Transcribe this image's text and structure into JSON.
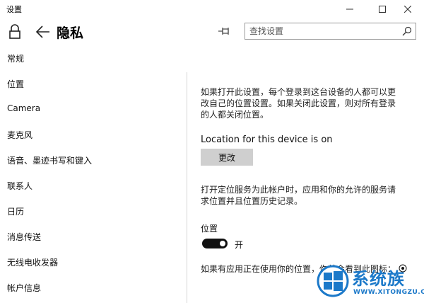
{
  "window": {
    "title": "设置"
  },
  "header": {
    "page_title": "隐私",
    "search_placeholder": "查找设置"
  },
  "sidebar": {
    "items": [
      {
        "label": "常规"
      },
      {
        "label": "位置"
      },
      {
        "label": "Camera"
      },
      {
        "label": "麦克风"
      },
      {
        "label": "语音、墨迹书写和键入"
      },
      {
        "label": "联系人"
      },
      {
        "label": "日历"
      },
      {
        "label": "消息传送"
      },
      {
        "label": "无线电收发器"
      },
      {
        "label": "帐户信息"
      }
    ]
  },
  "main": {
    "description": [
      "如果打开此设置，每个登录到这台设备的人都可以更",
      "改自己的位置设置。如果关闭此设置，则对所有登录",
      "的人都关闭位置。"
    ],
    "device_status": "Location for this device is on",
    "change_button": "更改",
    "service_desc": [
      "打开定位服务为此帐户时，应用和你的允许的服务请",
      "求位置并且位置历史记录。"
    ],
    "location_label": "位置",
    "location_state": "开",
    "location_on": true,
    "bottom_text": "如果有应用正在使用你的位置，你就会看到此图标："
  },
  "watermark": {
    "brand": "系统族",
    "url": "WWW.XITONGZU.COM"
  },
  "colors": {
    "watermark": "#1c79c9",
    "button_bg": "#cfcfcf",
    "toggle_on": "#111111"
  }
}
